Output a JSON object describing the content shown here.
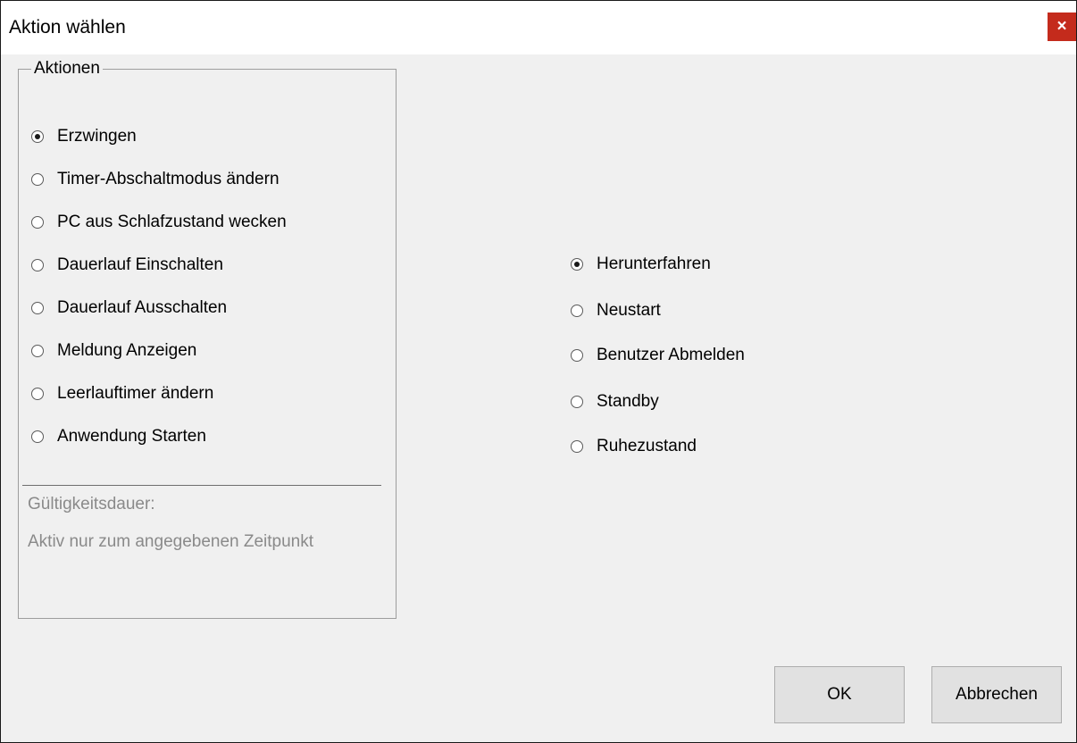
{
  "window": {
    "title": "Aktion wählen",
    "close_glyph": "×"
  },
  "actions_group": {
    "legend": "Aktionen",
    "options": [
      {
        "label": "Erzwingen",
        "checked": true
      },
      {
        "label": "Timer-Abschaltmodus ändern",
        "checked": false
      },
      {
        "label": "PC aus Schlafzustand wecken",
        "checked": false
      },
      {
        "label": "Dauerlauf Einschalten",
        "checked": false
      },
      {
        "label": "Dauerlauf Ausschalten",
        "checked": false
      },
      {
        "label": "Meldung Anzeigen",
        "checked": false
      },
      {
        "label": "Leerlauftimer ändern",
        "checked": false
      },
      {
        "label": "Anwendung Starten",
        "checked": false
      }
    ],
    "validity_label": "Gültigkeitsdauer:",
    "validity_value": "Aktiv nur zum angegebenen Zeitpunkt"
  },
  "shutdown_options": [
    {
      "label": "Herunterfahren",
      "checked": true
    },
    {
      "label": "Neustart",
      "checked": false
    },
    {
      "label": "Benutzer Abmelden",
      "checked": false
    },
    {
      "label": "Standby",
      "checked": false
    },
    {
      "label": "Ruhezustand",
      "checked": false
    }
  ],
  "buttons": {
    "ok": "OK",
    "cancel": "Abbrechen"
  },
  "colors": {
    "close_button": "#c42b1c",
    "dialog_background": "#f0f0f0",
    "disabled_text": "#8a8a8a"
  }
}
